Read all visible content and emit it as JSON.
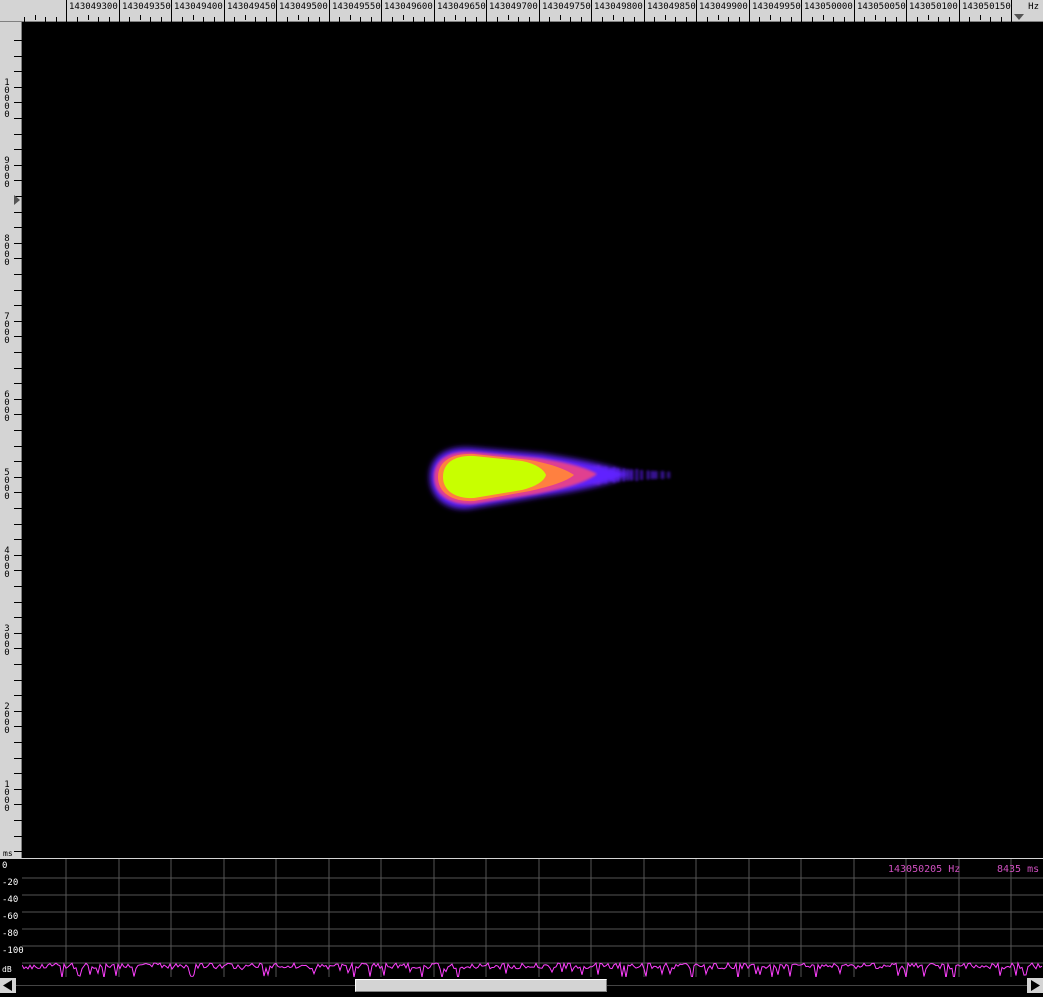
{
  "frequency_ruler": {
    "unit": "Hz",
    "labels": [
      "143049300",
      "143049350",
      "143049400",
      "143049450",
      "143049500",
      "143049550",
      "143049600",
      "143049650",
      "143049700",
      "143049750",
      "143049800",
      "143049850",
      "143049900",
      "143049950",
      "143050000",
      "143050050",
      "143050100",
      "143050150"
    ]
  },
  "time_ruler": {
    "unit": "ms",
    "labels": [
      "10000",
      "9000",
      "8000",
      "7000",
      "6000",
      "5000",
      "4000",
      "3000",
      "2000",
      "1000"
    ]
  },
  "spectrum": {
    "db_labels": [
      "0",
      "-20",
      "-40",
      "-60",
      "-80",
      "-100",
      "dB"
    ],
    "readout_frequency": "143050205 Hz",
    "readout_time": "8435 ms"
  },
  "colors": {
    "ruler_bg": "#d4d4d4",
    "waterfall_bg": "#000000",
    "signal_core": "#c8ff00",
    "signal_mid": "#ff8040",
    "signal_edge": "#6020ff",
    "trace": "#ff40ff",
    "readout": "#d050c0"
  },
  "icons": {
    "scroll_left": "triangle-left-icon",
    "scroll_right": "triangle-right-icon",
    "time_cursor": "triangle-right-marker-icon",
    "freq_cursor": "triangle-down-marker-icon"
  }
}
